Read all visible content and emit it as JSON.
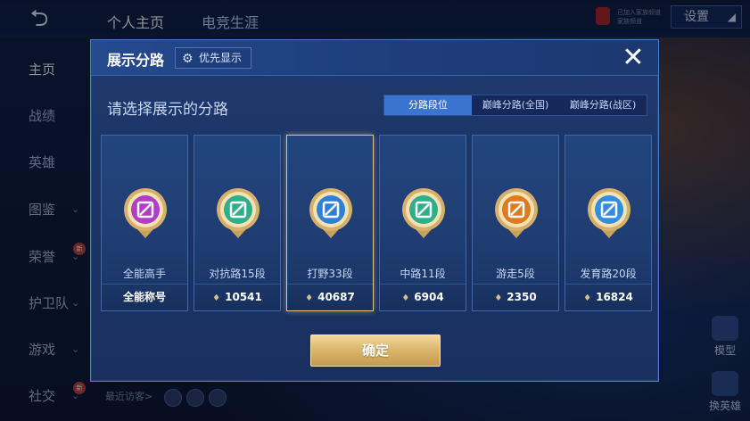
{
  "top_tabs": [
    "个人主页",
    "电竞生涯"
  ],
  "settings": {
    "label": "设置"
  },
  "status_chip": {
    "line1": "已加入家族频道",
    "line2": "家族频道"
  },
  "sidebar": {
    "items": [
      {
        "label": "主页",
        "active": true,
        "has_chevron": false
      },
      {
        "label": "战绩",
        "active": false,
        "has_chevron": false
      },
      {
        "label": "英雄",
        "active": false,
        "has_chevron": false
      },
      {
        "label": "图鉴",
        "active": false,
        "has_chevron": true
      },
      {
        "label": "荣誉",
        "active": false,
        "has_chevron": true,
        "badge": "新"
      },
      {
        "label": "护卫队",
        "active": false,
        "has_chevron": true
      },
      {
        "label": "游戏",
        "active": false,
        "has_chevron": true
      },
      {
        "label": "社交",
        "active": false,
        "has_chevron": true,
        "badge": "新"
      }
    ]
  },
  "bottom": {
    "recent_visitors_label": "最近访客>"
  },
  "right_widgets": {
    "model_label": "模型",
    "swap_hero_label": "换英雄"
  },
  "modal": {
    "title": "展示分路",
    "priority_button": "优先显示",
    "subtitle": "请选择展示的分路",
    "tabs": [
      {
        "label": "分路段位",
        "active": true
      },
      {
        "label": "巅峰分路(全国)",
        "active": false
      },
      {
        "label": "巅峰分路(战区)",
        "active": false
      }
    ],
    "cards": [
      {
        "name": "全能高手",
        "footer": "全能称号",
        "has_gem": false,
        "selected": false,
        "icon": "all-round-badge-icon",
        "core": "#b03cc8"
      },
      {
        "name": "对抗路15段",
        "footer": "10541",
        "has_gem": true,
        "selected": false,
        "icon": "clash-lane-badge-icon",
        "core": "#2fae8a"
      },
      {
        "name": "打野33段",
        "footer": "40687",
        "has_gem": true,
        "selected": true,
        "icon": "jungle-badge-icon",
        "core": "#2f7fd8"
      },
      {
        "name": "中路11段",
        "footer": "6904",
        "has_gem": true,
        "selected": false,
        "icon": "mid-lane-badge-icon",
        "core": "#2fae8a"
      },
      {
        "name": "游走5段",
        "footer": "2350",
        "has_gem": true,
        "selected": false,
        "icon": "roam-badge-icon",
        "core": "#e07a20"
      },
      {
        "name": "发育路20段",
        "footer": "16824",
        "has_gem": true,
        "selected": false,
        "icon": "farm-lane-badge-icon",
        "core": "#2f8ee0"
      }
    ],
    "confirm_button": "确定"
  },
  "colors": {
    "accent": "#3b73d0",
    "gold": "#d9b46a",
    "panel": "#1c3566"
  }
}
